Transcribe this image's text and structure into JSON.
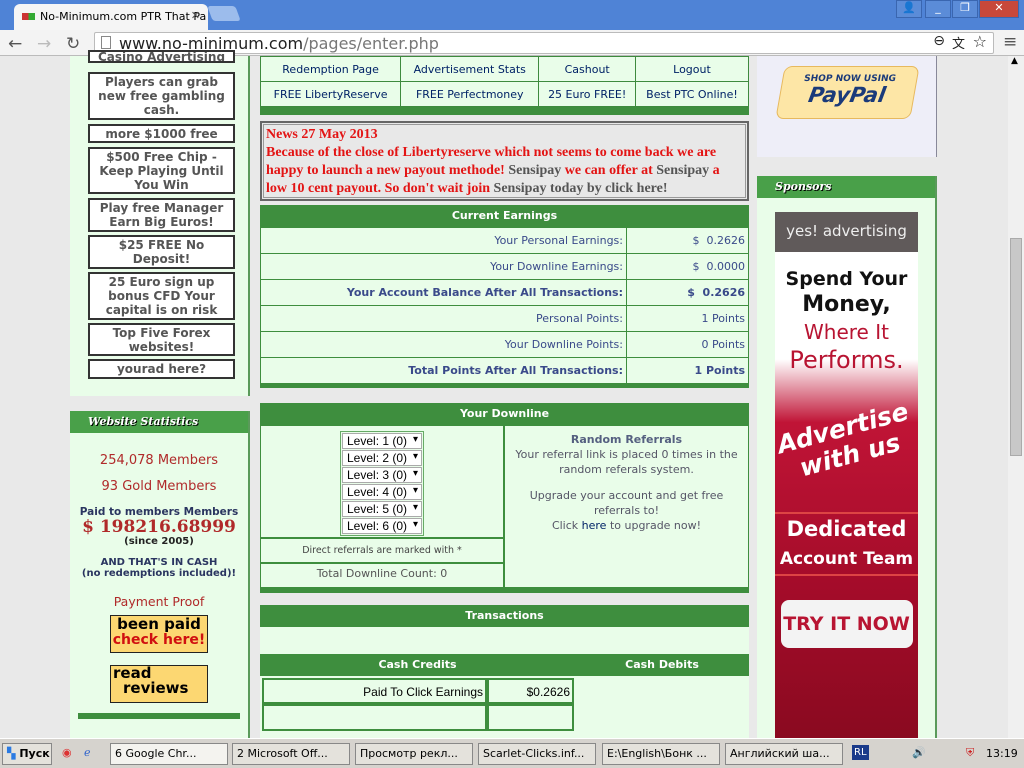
{
  "browser": {
    "tab_title": "No-Minimum.com PTR That Pa",
    "url_host": "www.no-minimum.com",
    "url_path": "/pages/enter.php"
  },
  "left_ads": [
    "Casino Advertising",
    "Players can grab new free gambling cash.",
    "more $1000 free",
    "$500 Free Chip - Keep Playing Until You Win",
    "Play free Manager Earn Big Euros!",
    "$25 FREE No Deposit!",
    "25 Euro sign up bonus CFD Your capital is on risk",
    "Top Five Forex websites!",
    "yourad here?"
  ],
  "stats": {
    "title": "Website Statistics",
    "members": "254,078 Members",
    "gold": "93 Gold Members",
    "paid_label": "Paid to members Members",
    "paid_amount": "$ 198216.68999",
    "since": "(since 2005)",
    "cash1": "AND THAT'S IN CASH",
    "cash2": "(no redemptions included)!",
    "proof": "Payment Proof",
    "been1": "been paid",
    "been2": "check here!",
    "read1": "read",
    "read2": "reviews"
  },
  "nav": [
    [
      "Redemption Page",
      "Advertisement Stats",
      "Cashout",
      "Logout"
    ],
    [
      "FREE LibertyReserve",
      "FREE Perfectmoney",
      "25 Euro FREE!",
      "Best PTC Online!"
    ]
  ],
  "news": {
    "title": "News 27 May 2013",
    "p1": "Because of the close of Libertyreserve which not seems to come back we are happy to launch a new payout methode! ",
    "s1": "Sensipay",
    "p2": " we can offer at ",
    "s2": "Sensipay",
    "p3": " a low 10 cent payout. So don't wait join ",
    "s3": "Sensipay today by click here!"
  },
  "earnings": {
    "title": "Current Earnings",
    "rows": [
      {
        "label": "Your Personal Earnings:",
        "value": "$  0.2626",
        "bold": false
      },
      {
        "label": "Your Downline Earnings:",
        "value": "$  0.0000",
        "bold": false
      },
      {
        "label": "Your Account Balance After All Transactions:",
        "value": "$  0.2626",
        "bold": true
      },
      {
        "label": "Personal Points:",
        "value": "1 Points",
        "bold": false
      },
      {
        "label": "Your Downline Points:",
        "value": "0 Points",
        "bold": false
      },
      {
        "label": "Total Points After All Transactions:",
        "value": "1 Points",
        "bold": true
      }
    ]
  },
  "downline": {
    "title": "Your Downline",
    "levels": [
      "Level: 1 (0)",
      "Level: 2 (0)",
      "Level: 3 (0)",
      "Level: 4 (0)",
      "Level: 5 (0)",
      "Level: 6 (0)"
    ],
    "direct_note": "Direct referrals are marked with *",
    "total": "Total Downline Count: 0",
    "rr_title": "Random Referrals",
    "rr_text": "Your referral link is placed 0 times in the random referals system.",
    "upgrade": "Upgrade your account and get free referrals to!",
    "click": "Click ",
    "here": "here",
    "click2": " to upgrade now!"
  },
  "transactions": {
    "title": "Transactions",
    "credits": "Cash Credits",
    "debits": "Cash Debits",
    "row_label": "Paid To Click Earnings",
    "row_value": "$0.2626"
  },
  "right": {
    "paypal_top": "SHOP NOW USING",
    "paypal": "PayPal",
    "sponsors": "Sponsors",
    "ad_brand": "yes! advertising",
    "ad1": "Spend Your",
    "ad2": "Money,",
    "ad3": "Where It",
    "ad4": "Performs.",
    "ad5": "Advertise with us",
    "ad6": "Dedicated",
    "ad7": "Account Team",
    "ad8": "TRY IT NOW"
  },
  "taskbar": {
    "start": "Пуск",
    "items": [
      "6 Google Chr...",
      "2 Microsoft Off...",
      "Просмотр рекл...",
      "Scarlet-Clicks.inf...",
      "E:\\English\\Бонк ...",
      "Английский ша..."
    ],
    "lang": "RL",
    "clock": "13:19"
  }
}
